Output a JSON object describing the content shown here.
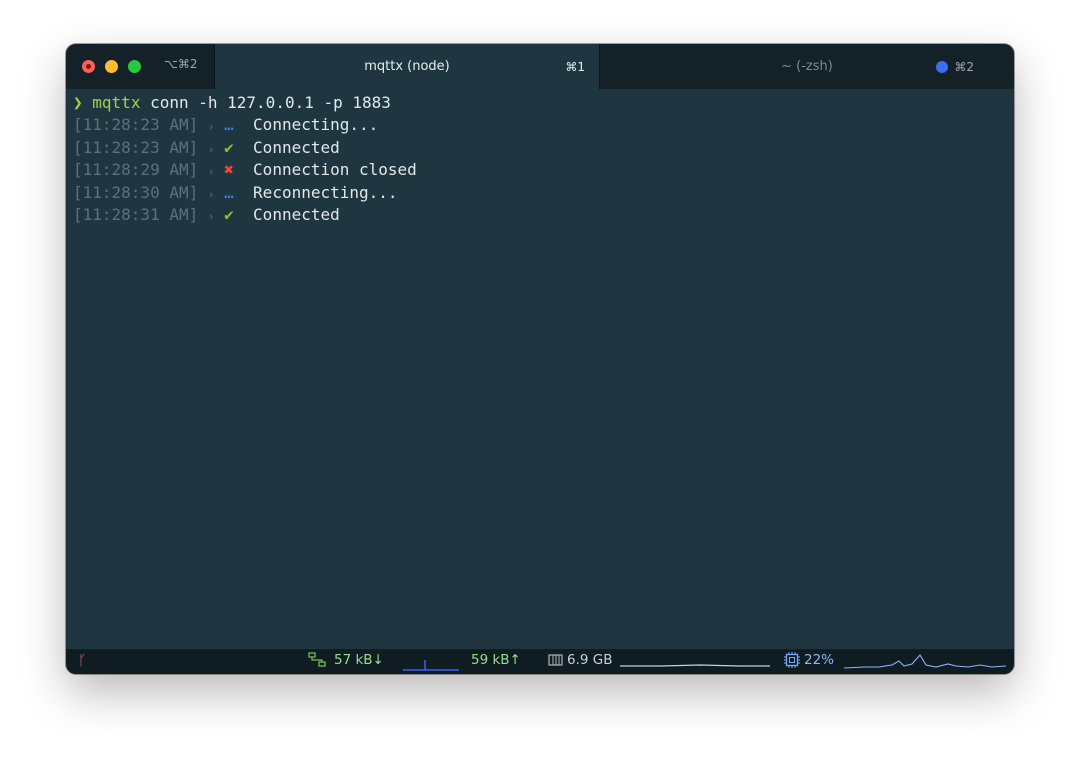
{
  "window": {
    "shortcut_left": "⌥⌘2",
    "tabs": [
      {
        "label": "mqttx (node)",
        "shortcut": "⌘1",
        "active": true
      },
      {
        "label": "~ (-zsh)",
        "shortcut": "⌘2",
        "active": false
      }
    ]
  },
  "terminal": {
    "prompt": "❯",
    "command_name": "mqttx",
    "command_args": " conn -h 127.0.0.1 -p 1883",
    "log": [
      {
        "time": "[11:28:23 AM]",
        "sep": "›",
        "icon": "…",
        "kind": "pending",
        "message": "Connecting..."
      },
      {
        "time": "[11:28:23 AM]",
        "sep": "›",
        "icon": "✔",
        "kind": "success",
        "message": "Connected"
      },
      {
        "time": "[11:28:29 AM]",
        "sep": "›",
        "icon": "✖",
        "kind": "error",
        "message": "Connection closed"
      },
      {
        "time": "[11:28:30 AM]",
        "sep": "›",
        "icon": "…",
        "kind": "pending",
        "message": "Reconnecting..."
      },
      {
        "time": "[11:28:31 AM]",
        "sep": "›",
        "icon": "✔",
        "kind": "success",
        "message": "Connected"
      }
    ]
  },
  "statusbar": {
    "branch_icon": "ᚴ",
    "net_icon": "network-icon",
    "down": "57 kB↓",
    "up": "59 kB↑",
    "mem_icon": "memory-icon",
    "mem": "6.9 GB",
    "cpu_icon": "cpu-icon",
    "cpu": "22%"
  },
  "colors": {
    "terminal_bg": "#1f3640",
    "titlebar_bg": "#142128",
    "accent_green": "#a6d14b",
    "pending_blue": "#3f82ff",
    "error_red": "#f0483b"
  }
}
